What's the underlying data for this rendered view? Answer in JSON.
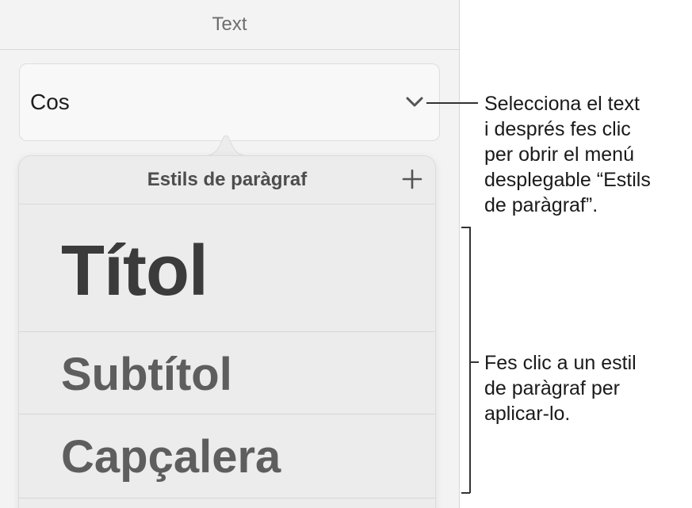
{
  "panel": {
    "header_title": "Text",
    "style_field": {
      "value": "Cos",
      "icon": "chevron-down-icon"
    }
  },
  "popover": {
    "title": "Estils de paràgraf",
    "add_icon": "plus-icon",
    "styles": [
      {
        "label": "Títol"
      },
      {
        "label": "Subtítol"
      },
      {
        "label": "Capçalera"
      }
    ]
  },
  "callouts": {
    "dropdown": "Selecciona el text\ni després fes clic\nper obrir el menú\ndesplegable “Estils\nde paràgraf”.",
    "styles": "Fes clic a un estil\nde paràgraf per\naplicar-lo."
  }
}
